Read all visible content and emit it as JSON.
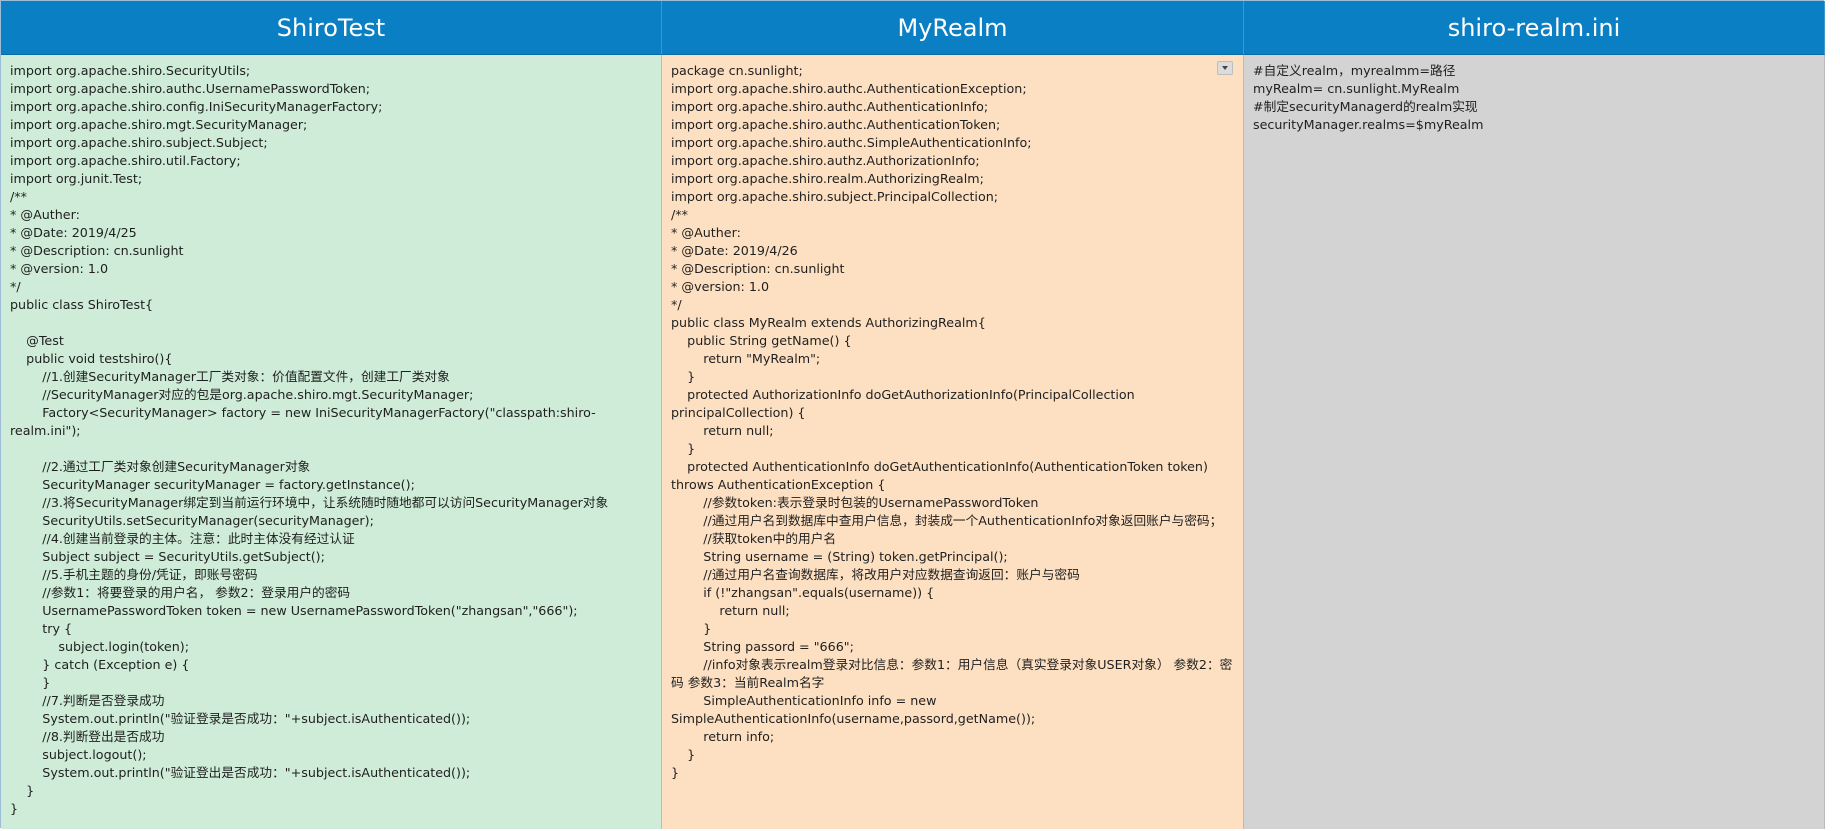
{
  "columns": [
    {
      "title": "ShiroTest",
      "code": "import org.apache.shiro.SecurityUtils;\nimport org.apache.shiro.authc.UsernamePasswordToken;\nimport org.apache.shiro.config.IniSecurityManagerFactory;\nimport org.apache.shiro.mgt.SecurityManager;\nimport org.apache.shiro.subject.Subject;\nimport org.apache.shiro.util.Factory;\nimport org.junit.Test;\n/**\n* @Auther:\n* @Date: 2019/4/25\n* @Description: cn.sunlight\n* @version: 1.0\n*/\npublic class ShiroTest{\n\n    @Test\n    public void testshiro(){\n        //1.创建SecurityManager工厂类对象：价值配置文件，创建工厂类对象\n        //SecurityManager对应的包是org.apache.shiro.mgt.SecurityManager;\n        Factory<SecurityManager> factory = new IniSecurityManagerFactory(\"classpath:shiro-realm.ini\");\n\n        //2.通过工厂类对象创建SecurityManager对象\n        SecurityManager securityManager = factory.getInstance();\n        //3.将SecurityManager绑定到当前运行环境中，让系统随时随地都可以访问SecurityManager对象\n        SecurityUtils.setSecurityManager(securityManager);\n        //4.创建当前登录的主体。注意：此时主体没有经过认证\n        Subject subject = SecurityUtils.getSubject();\n        //5.手机主题的身份/凭证，即账号密码\n        //参数1：将要登录的用户名， 参数2：登录用户的密码\n        UsernamePasswordToken token = new UsernamePasswordToken(\"zhangsan\",\"666\");\n        try {\n            subject.login(token);\n        } catch (Exception e) {\n        }\n        //7.判断是否登录成功\n        System.out.println(\"验证登录是否成功：\"+subject.isAuthenticated());\n        //8.判断登出是否成功\n        subject.logout();\n        System.out.println(\"验证登出是否成功：\"+subject.isAuthenticated());\n    }\n}"
    },
    {
      "title": "MyRealm",
      "code": "package cn.sunlight;\nimport org.apache.shiro.authc.AuthenticationException;\nimport org.apache.shiro.authc.AuthenticationInfo;\nimport org.apache.shiro.authc.AuthenticationToken;\nimport org.apache.shiro.authc.SimpleAuthenticationInfo;\nimport org.apache.shiro.authz.AuthorizationInfo;\nimport org.apache.shiro.realm.AuthorizingRealm;\nimport org.apache.shiro.subject.PrincipalCollection;\n/**\n* @Auther:\n* @Date: 2019/4/26\n* @Description: cn.sunlight\n* @version: 1.0\n*/\npublic class MyRealm extends AuthorizingRealm{\n    public String getName() {\n        return \"MyRealm\";\n    }\n    protected AuthorizationInfo doGetAuthorizationInfo(PrincipalCollection principalCollection) {\n        return null;\n    }\n    protected AuthenticationInfo doGetAuthenticationInfo(AuthenticationToken token) throws AuthenticationException {\n        //参数token:表示登录时包装的UsernamePasswordToken\n        //通过用户名到数据库中查用户信息，封装成一个AuthenticationInfo对象返回账户与密码；\n        //获取token中的用户名\n        String username = (String) token.getPrincipal();\n        //通过用户名查询数据库，将改用户对应数据查询返回：账户与密码\n        if (!\"zhangsan\".equals(username)) {\n            return null;\n        }\n        String passord = \"666\";\n        //info对象表示realm登录对比信息：参数1：用户信息（真实登录对象USER对象） 参数2：密码 参数3：当前Realm名字\n        SimpleAuthenticationInfo info = new SimpleAuthenticationInfo(username,passord,getName());\n        return info;\n    }\n}"
    },
    {
      "title": "shiro-realm.ini",
      "code": "#自定义realm，myrealmm=路径\nmyRealm= cn.sunlight.MyRealm\n#制定securityManagerd的realm实现\nsecurityManager.realms=$myRealm"
    }
  ],
  "colors": {
    "header": "#0a7fc3",
    "panel_shirotest": "#ceecd7",
    "panel_myrealm": "#fde0c2",
    "panel_ini": "#d3d3d3"
  },
  "icons": {
    "myrealm_dropdown": "chevron-down-icon"
  }
}
